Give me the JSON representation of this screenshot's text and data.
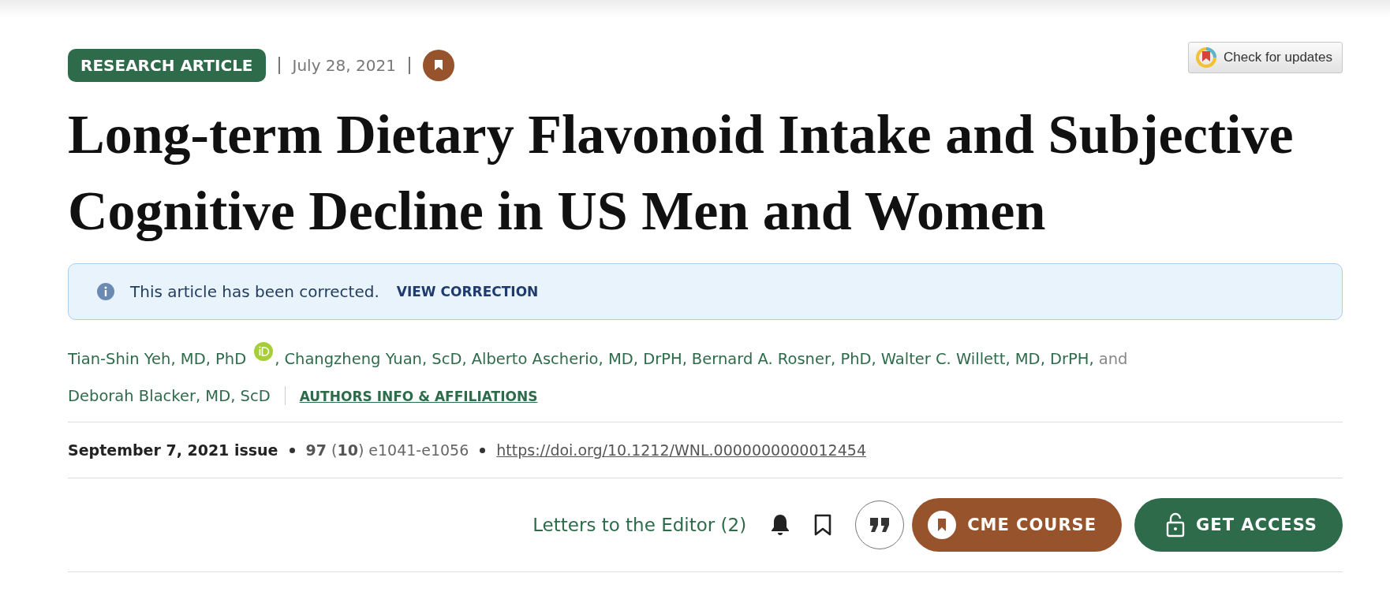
{
  "header": {
    "badge": "RESEARCH ARTICLE",
    "date": "July 28, 2021",
    "bookmarked": true,
    "updates_button": "Check for updates"
  },
  "title": "Long-term Dietary Flavonoid Intake and Subjective Cognitive Decline in US Men and Women",
  "notice": {
    "text": "This article has been corrected.",
    "link": "VIEW CORRECTION"
  },
  "authors": [
    {
      "name": "Tian-Shin Yeh, MD, PhD",
      "orcid": true,
      "separator": ","
    },
    {
      "name": "Changzheng Yuan, ScD",
      "orcid": false,
      "separator": ","
    },
    {
      "name": "Alberto Ascherio, MD, DrPH",
      "orcid": false,
      "separator": ","
    },
    {
      "name": "Bernard A. Rosner, PhD",
      "orcid": false,
      "separator": ","
    },
    {
      "name": "Walter C. Willett, MD, DrPH",
      "orcid": false,
      "separator": ",",
      "conjunction": "and"
    },
    {
      "name": "Deborah Blacker, MD, ScD",
      "orcid": false
    }
  ],
  "affiliations_link": "AUTHORS INFO & AFFILIATIONS",
  "issue": {
    "date": "September 7, 2021 issue",
    "pages": "**97** (**10**) e1041-e1056",
    "doi": "https://doi.org/10.1212/WNL.0000000000012454"
  },
  "actions": {
    "letters": "Letters to the Editor (2)",
    "cme": "CME COURSE",
    "access": "GET ACCESS"
  }
}
